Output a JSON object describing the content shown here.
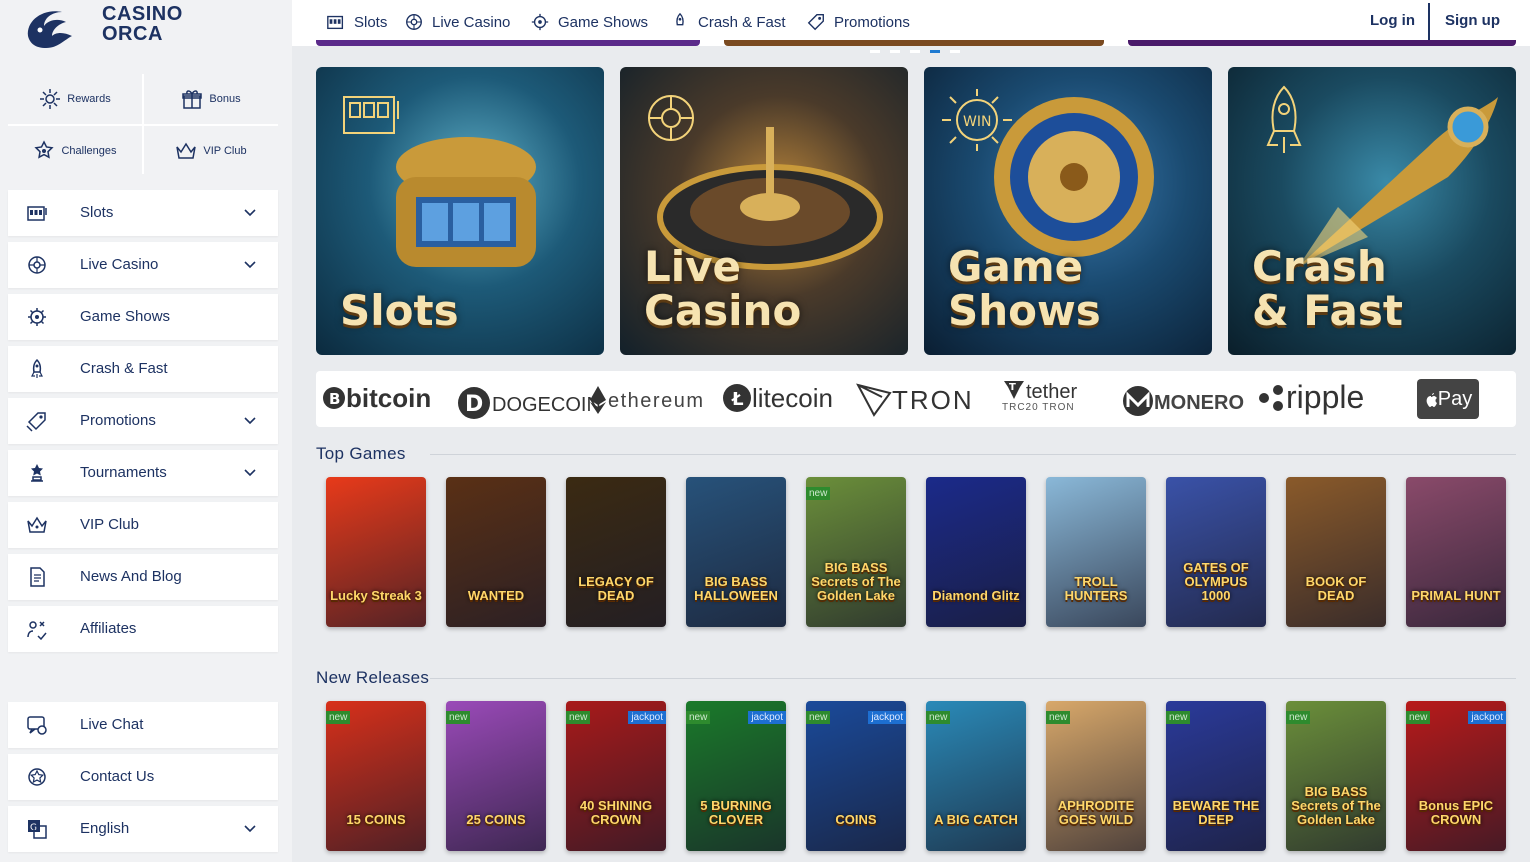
{
  "brand": {
    "line1": "CASINO",
    "line2": "ORCA"
  },
  "quick_links": [
    {
      "label": "Rewards",
      "icon": "rewards-icon"
    },
    {
      "label": "Bonus",
      "icon": "gift-icon"
    },
    {
      "label": "Challenges",
      "icon": "challenges-icon"
    },
    {
      "label": "VIP Club",
      "icon": "crown-icon"
    }
  ],
  "sidebar": {
    "items": [
      {
        "label": "Slots",
        "icon": "slot-machine-icon",
        "expandable": true
      },
      {
        "label": "Live Casino",
        "icon": "roulette-icon",
        "expandable": true
      },
      {
        "label": "Game Shows",
        "icon": "wheel-icon",
        "expandable": false
      },
      {
        "label": "Crash & Fast",
        "icon": "rocket-icon",
        "expandable": false
      },
      {
        "label": "Promotions",
        "icon": "tag-icon",
        "expandable": true
      },
      {
        "label": "Tournaments",
        "icon": "trophy-icon",
        "expandable": true
      },
      {
        "label": "VIP Club",
        "icon": "crown-icon",
        "expandable": false
      },
      {
        "label": "News And Blog",
        "icon": "document-icon",
        "expandable": false
      },
      {
        "label": "Affiliates",
        "icon": "affiliates-icon",
        "expandable": false
      }
    ],
    "bottom": [
      {
        "label": "Live Chat",
        "icon": "chat-icon",
        "expandable": false
      },
      {
        "label": "Contact Us",
        "icon": "contact-icon",
        "expandable": false
      },
      {
        "label": "English",
        "icon": "translate-icon",
        "expandable": true
      }
    ]
  },
  "topnav": [
    {
      "label": "Slots",
      "icon": "slot-machine-icon"
    },
    {
      "label": "Live Casino",
      "icon": "roulette-icon"
    },
    {
      "label": "Game Shows",
      "icon": "wheel-icon"
    },
    {
      "label": "Crash & Fast",
      "icon": "rocket-icon"
    },
    {
      "label": "Promotions",
      "icon": "tag-icon"
    }
  ],
  "auth": {
    "login": "Log in",
    "signup": "Sign up"
  },
  "carousel": {
    "slide_count": 5,
    "active_index": 3
  },
  "banners": [
    {
      "line1": "",
      "line2": "Slots"
    },
    {
      "line1": "Live",
      "line2": "Casino"
    },
    {
      "line1": "Game",
      "line2": "Shows"
    },
    {
      "line1": "Crash",
      "line2": "& Fast"
    }
  ],
  "payment_methods": [
    "bitcoin",
    "DOGECOIN",
    "ethereum",
    "litecoin",
    "TRON",
    "tether",
    "MONERO",
    "ripple",
    "Pay"
  ],
  "payment_sub": {
    "tether": "TRC20  TRON"
  },
  "sections": {
    "top_games": "Top Games",
    "new_releases": "New Releases"
  },
  "top_games": [
    {
      "name": "Lucky Streak 3",
      "new": false,
      "jackpot": false,
      "bg": "#e83a1a"
    },
    {
      "name": "WANTED",
      "new": false,
      "jackpot": false,
      "bg": "#5a3015"
    },
    {
      "name": "LEGACY OF DEAD",
      "new": false,
      "jackpot": false,
      "bg": "#3b2a12"
    },
    {
      "name": "BIG BASS HALLOWEEN",
      "new": false,
      "jackpot": false,
      "bg": "#27527a"
    },
    {
      "name": "BIG BASS Secrets of The Golden Lake",
      "new": true,
      "jackpot": false,
      "bg": "#6b8f3a"
    },
    {
      "name": "Diamond Glitz",
      "new": false,
      "jackpot": false,
      "bg": "#1b2a8a"
    },
    {
      "name": "TROLL HUNTERS",
      "new": false,
      "jackpot": false,
      "bg": "#8ab8d8"
    },
    {
      "name": "GATES OF OLYMPUS 1000",
      "new": false,
      "jackpot": false,
      "bg": "#3a52a8"
    },
    {
      "name": "BOOK OF DEAD",
      "new": false,
      "jackpot": false,
      "bg": "#8a5a2a"
    },
    {
      "name": "PRIMAL HUNT",
      "new": false,
      "jackpot": false,
      "bg": "#8a4a6a"
    }
  ],
  "new_releases": [
    {
      "name": "15 COINS",
      "new": true,
      "jackpot": false,
      "bg": "#d8301a"
    },
    {
      "name": "25 COINS",
      "new": true,
      "jackpot": false,
      "bg": "#9a4ab8"
    },
    {
      "name": "40 SHINING CROWN",
      "new": true,
      "jackpot": true,
      "bg": "#a81a1a"
    },
    {
      "name": "5 BURNING CLOVER",
      "new": true,
      "jackpot": true,
      "bg": "#1a7a2a"
    },
    {
      "name": "COINS",
      "new": true,
      "jackpot": true,
      "bg": "#1a4a9a"
    },
    {
      "name": "A BIG CATCH",
      "new": true,
      "jackpot": false,
      "bg": "#2a8ab8"
    },
    {
      "name": "APHRODITE GOES WILD",
      "new": true,
      "jackpot": false,
      "bg": "#d8a86a"
    },
    {
      "name": "BEWARE THE DEEP",
      "new": true,
      "jackpot": false,
      "bg": "#2a3a9a"
    },
    {
      "name": "BIG BASS Secrets of The Golden Lake",
      "new": true,
      "jackpot": false,
      "bg": "#6b8f3a"
    },
    {
      "name": "Bonus EPIC CROWN",
      "new": true,
      "jackpot": true,
      "bg": "#b81a1a"
    }
  ],
  "tag_labels": {
    "new": "new",
    "jackpot": "jackpot"
  },
  "colors": {
    "accent": "#1d3262",
    "active_dot": "#1f7ad1",
    "new_badge": "#2e8b2e",
    "jackpot_badge": "#1d6fd1"
  }
}
